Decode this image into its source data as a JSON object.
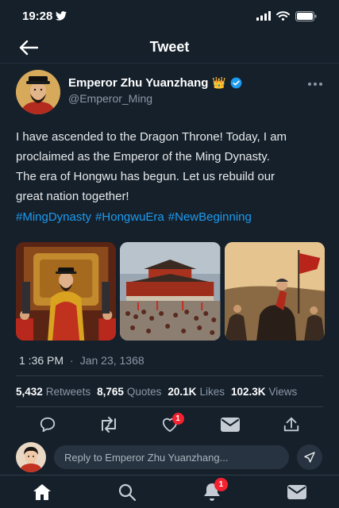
{
  "status_bar": {
    "time": "19:28"
  },
  "header": {
    "title": "Tweet"
  },
  "author": {
    "display_name": "Emperor Zhu Yuanzhang",
    "handle": "@Emperor_Ming",
    "badge_emoji": "👑"
  },
  "tweet": {
    "lines": [
      "I have ascended to the Dragon Throne! Today, I am",
      "proclaimed as the Emperor of the Ming Dynasty.",
      "The era of Hongwu has begun. Let us rebuild our",
      "great nation together!"
    ],
    "hashtags": [
      "#MingDynasty",
      "#HongwuEra",
      "#NewBeginning"
    ],
    "time": "1 :36 PM",
    "separator": "·",
    "date": "Jan 23, 1368"
  },
  "stats": {
    "retweets": {
      "value": "5,432",
      "label": "Retweets"
    },
    "quotes": {
      "value": "8,765",
      "label": "Quotes"
    },
    "likes": {
      "value": "20.1K",
      "label": "Likes"
    },
    "views": {
      "value": "102.3K",
      "label": "Views"
    }
  },
  "actions": {
    "like_badge": "1"
  },
  "reply": {
    "placeholder": "Reply to Emperor Zhu Yuanzhang..."
  },
  "tabs": {
    "notifications_badge": "1"
  },
  "colors": {
    "background": "#15202b",
    "accent": "#1d9bf0",
    "badge": "#f4212e",
    "verified": "#1d9bf0"
  }
}
